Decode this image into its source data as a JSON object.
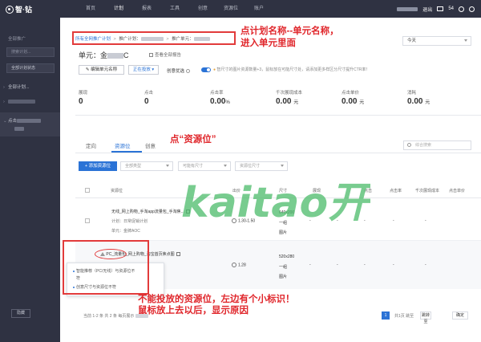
{
  "topbar": {
    "logo": "智·钻",
    "nav": [
      "首页",
      "计划",
      "报表",
      "工具",
      "创意",
      "资源位",
      "账户"
    ],
    "active_nav": "计划",
    "logout": "退出",
    "msg_count": "54"
  },
  "sidebar": {
    "title": "全部推广",
    "search_placeholder": "搜索计划...",
    "select_value": "全部计划状态",
    "row1": "全部计划...",
    "row2_prefix": "点击",
    "bottom_btn": "隐藏"
  },
  "breadcrumb": {
    "c1": "所有全网推广计划",
    "c2": "推广计划：",
    "c3": "推广单元：",
    "sep": ">"
  },
  "annotations": {
    "a1_line1": "点计划名称--单元名称，",
    "a1_line2": "进入单元里面",
    "a2": "点“资源位”",
    "a3_line1": "不能投放的资源位，左边有个小标识！",
    "a3_line2": "鼠标放上去以后，显示原因"
  },
  "unit": {
    "title_prefix": "单元：金",
    "title_suffix": "C",
    "view_link": "查看全部报告",
    "date_select": "今天",
    "edit_btn": "编辑单元名称",
    "status_btn": "正在投放",
    "optimize_label": "创意优选",
    "tip": "智尺寸的图片资源数量+3，鼠标放在可能尺寸处，请添加更多样区分尺寸提升CTR率！"
  },
  "stats": [
    {
      "label": "展现",
      "value": "0",
      "unit": ""
    },
    {
      "label": "点击",
      "value": "0",
      "unit": ""
    },
    {
      "label": "点击率",
      "value": "0.00",
      "unit": "%"
    },
    {
      "label": "千次展现成本",
      "value": "0.00",
      "unit": "元"
    },
    {
      "label": "点击单价",
      "value": "0.00",
      "unit": "元"
    },
    {
      "label": "消耗",
      "value": "0.00",
      "unit": "元"
    }
  ],
  "tabs": [
    "定向",
    "资源位",
    "创意"
  ],
  "active_tab": "资源位",
  "search_placeholder": "综合搜索",
  "toolbar": {
    "add_btn": "+ 添加资源位",
    "filter1": "全部类型",
    "filter2": "可能有尺寸",
    "filter3": "资源位尺寸"
  },
  "table": {
    "headers": [
      "资源位",
      "出价",
      "尺寸",
      "展现",
      "点击",
      "点击率",
      "千次展现成本",
      "点击单价"
    ],
    "rows": [
      {
        "name": "无线_网上购物_手淘app流量包_手淘焦...",
        "plan": "计划：日常促销计划",
        "unit": "单元：金牌AOC",
        "bid": "1.30-1.50",
        "size_l1": "640x200",
        "size_l2": "一组",
        "size_l3": "图片",
        "dash": "-"
      },
      {
        "name": "PC_流量包_网上购物_淘宝首页焦点图",
        "bid": "1.28",
        "size_l1": "520x280",
        "size_l2": "一组",
        "size_l3": "图片",
        "dash": "-"
      }
    ]
  },
  "popover": {
    "line1": "智能推荐（PC/无线）与资源位不",
    "line2": "符",
    "line3": "创意尺寸与资源位不符"
  },
  "footer": {
    "summary": "当前 1-2 条   共 2 条   每页展示",
    "page": "1",
    "goto_label": "共1页 跳至",
    "pre": "跳转至",
    "go": "确定"
  },
  "watermark": "kaitao开淘"
}
